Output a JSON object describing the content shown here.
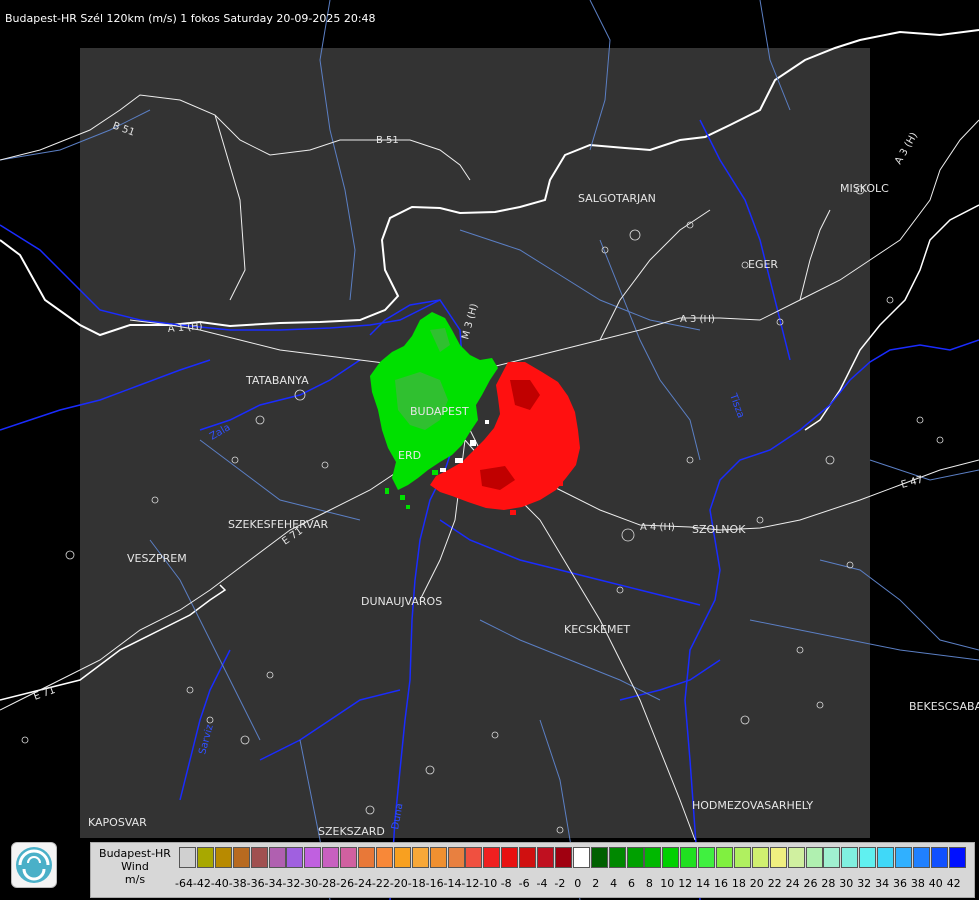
{
  "header": {
    "title": "Budapest-HR Szél 120km (m/s) 1 fokos Saturday 20-09-2025 20:48"
  },
  "map": {
    "cities": [
      "SALGOTARJAN",
      "MISKOLC",
      "EGER",
      "TATABANYA",
      "BUDAPEST",
      "ERD",
      "SZEKESFEHERVAR",
      "VESZPREM",
      "DUNAUJVAROS",
      "KECSKEMET",
      "SZOLNOK",
      "BEKESCSABA",
      "HODMEZOVASARHELY",
      "KAPOSVAR",
      "SZEKSZARD"
    ],
    "roads": [
      "B 51",
      "B 51",
      "A 3 (H)",
      "A 3 (H)",
      "A 4 (H)",
      "E 47",
      "E 71",
      "E 71",
      "A 1 (H)",
      "M 3 (H)"
    ],
    "rivers": [
      "Zala",
      "Tisza",
      "Sarviz",
      "Duna"
    ],
    "colors": {
      "approaching": "#00e000",
      "receding": "#ff1010",
      "dark_area": "#333333",
      "border": "#ffffff",
      "roads": "#eeeeee",
      "rivers": "#1a2cff"
    }
  },
  "legend": {
    "label_lines": [
      "Budapest-HR",
      "Wind",
      "m/s"
    ],
    "ticks": [
      "-64",
      "-42",
      "-40",
      "-38",
      "-36",
      "-34",
      "-32",
      "-30",
      "-28",
      "-26",
      "-24",
      "-22",
      "-20",
      "-18",
      "-16",
      "-14",
      "-12",
      "-10",
      "-8",
      "-6",
      "-4",
      "-2",
      "0",
      "2",
      "4",
      "6",
      "8",
      "10",
      "12",
      "14",
      "16",
      "18",
      "20",
      "22",
      "24",
      "26",
      "28",
      "30",
      "32",
      "34",
      "36",
      "38",
      "40",
      "42"
    ],
    "colors": [
      "#d0d0d0",
      "#a8a800",
      "#b88a00",
      "#b86a20",
      "#a05050",
      "#b060b0",
      "#a060e0",
      "#c060e0",
      "#c860c0",
      "#d060a0",
      "#e87838",
      "#f88838",
      "#f8a020",
      "#f8a838",
      "#f09030",
      "#e88040",
      "#f05040",
      "#f02020",
      "#e81010",
      "#d01010",
      "#c01020",
      "#a00010",
      "#ffffff",
      "#006000",
      "#008800",
      "#00a000",
      "#00b800",
      "#00d000",
      "#20e020",
      "#40f040",
      "#80f040",
      "#b0f060",
      "#d0f070",
      "#f0f080",
      "#d0f0a0",
      "#b0f0b0",
      "#a0f0d0",
      "#80f0e0",
      "#60f0f0",
      "#40d8f8",
      "#30b0ff",
      "#2080ff",
      "#1050ff",
      "#0010ff"
    ]
  },
  "logo": {
    "icon": "hungarian-met-service-logo-icon"
  }
}
